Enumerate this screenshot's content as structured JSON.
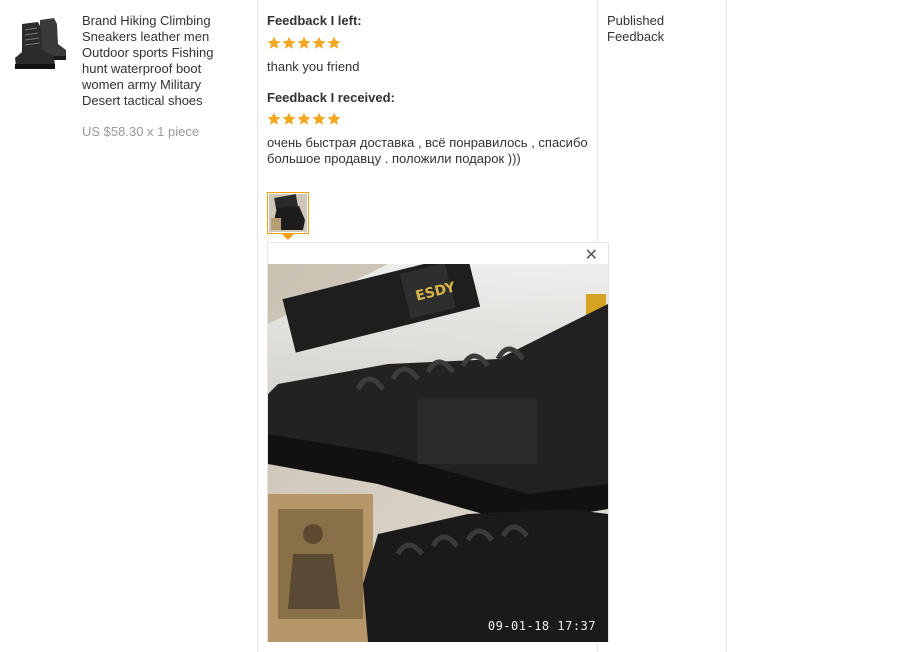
{
  "product": {
    "thumbnail_icon": "hiking-boot-image",
    "title": "Brand Hiking Climbing Sneakers leather men Outdoor sports Fishing hunt waterproof boot women army Military Desert tactical shoes",
    "price": "US $58.30 x 1 piece"
  },
  "feedback_left": {
    "heading": "Feedback I left:",
    "rating": 5,
    "rating_max": 5,
    "text": "thank you friend"
  },
  "feedback_received": {
    "heading": "Feedback I received:",
    "rating": 5,
    "rating_max": 5,
    "text": "очень быстрая доставка , всё понравилось , спасибо большое продавцу . положили подарок )))",
    "photo_icon": "boot-photo-thumbnail"
  },
  "photo_viewer": {
    "close_glyph": "✕",
    "timestamp": "09-01-18  17:37"
  },
  "status": {
    "text": "Published Feedback"
  },
  "colors": {
    "star": "#f5a623",
    "price": "#999999",
    "divider": "#e8e8e8",
    "thumb_border": "#f2a000"
  }
}
